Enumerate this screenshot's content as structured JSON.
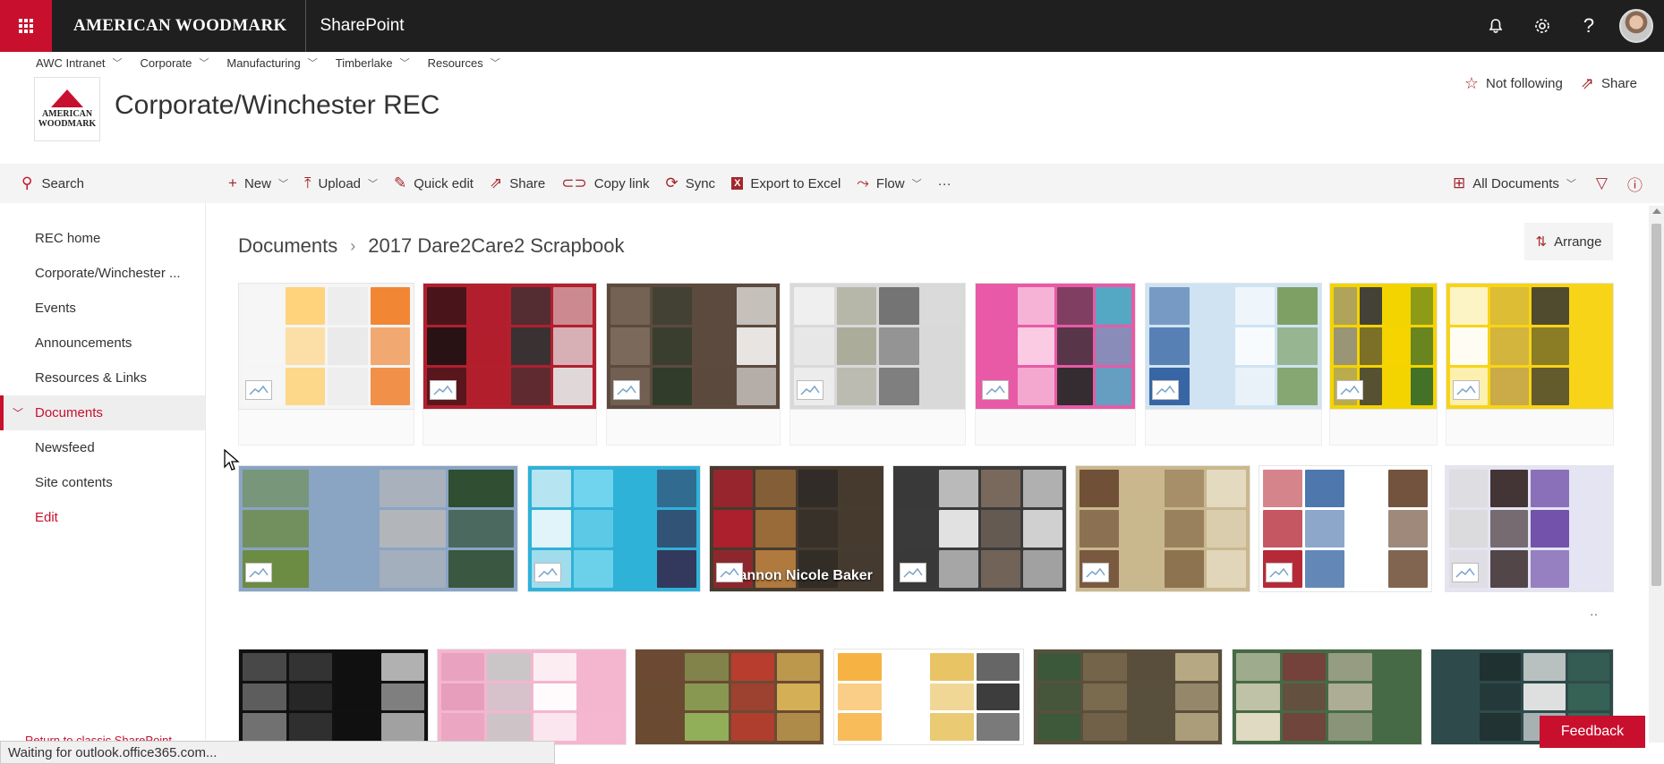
{
  "suite": {
    "brand": "AMERICAN WOODMARK",
    "app_name": "SharePoint"
  },
  "hub_nav": [
    {
      "label": "AWC Intranet"
    },
    {
      "label": "Corporate"
    },
    {
      "label": "Manufacturing"
    },
    {
      "label": "Timberlake"
    },
    {
      "label": "Resources"
    }
  ],
  "site": {
    "logo_text_line1": "AMERICAN",
    "logo_text_line2": "WOODMARK",
    "title": "Corporate/Winchester REC",
    "follow_label": "Not following",
    "share_label": "Share"
  },
  "search": {
    "label": "Search"
  },
  "commands": {
    "new": "New",
    "upload": "Upload",
    "quick_edit": "Quick edit",
    "share": "Share",
    "copy_link": "Copy link",
    "sync": "Sync",
    "export": "Export to Excel",
    "flow": "Flow",
    "more": "···",
    "view": "All Documents"
  },
  "left_nav": [
    {
      "label": "REC home"
    },
    {
      "label": "Corporate/Winchester ..."
    },
    {
      "label": "Events"
    },
    {
      "label": "Announcements"
    },
    {
      "label": "Resources & Links"
    },
    {
      "label": "Documents"
    },
    {
      "label": "Newsfeed"
    },
    {
      "label": "Site contents"
    },
    {
      "label": "Edit"
    }
  ],
  "return_classic": "Return to classic SharePoint",
  "breadcrumb": {
    "root": "Documents",
    "current": "2017 Dare2Care2 Scrapbook"
  },
  "arrange_label": "Arrange",
  "tile_texts": {
    "row2_tile3": "Shannon Nicole Baker"
  },
  "status_text": "Waiting for outlook.office365.com...",
  "feedback_label": "Feedback",
  "colors": {
    "accent": "#c8102e",
    "suite_bar": "#1f1f1f"
  }
}
